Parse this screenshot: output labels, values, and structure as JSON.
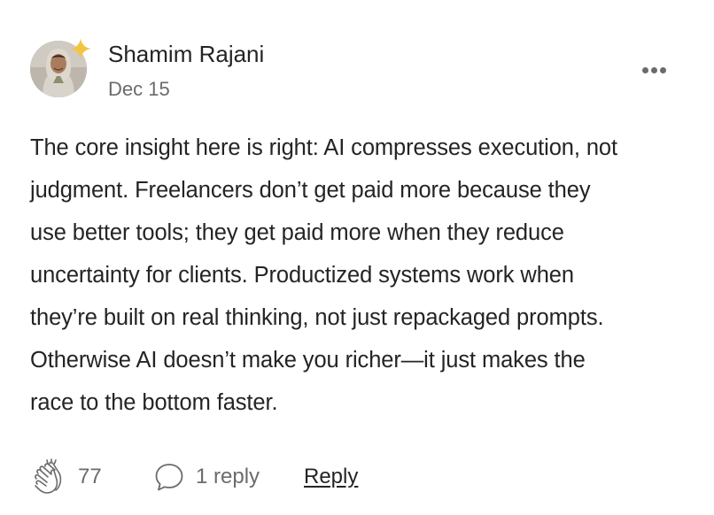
{
  "comment": {
    "author": {
      "name": "Shamim Rajani",
      "avatar_icon": "user-avatar-photo",
      "badge_icon": "sparkle-star-icon",
      "badge_color": "#F4C542"
    },
    "date": "Dec 15",
    "body": "The core insight here is right: AI compresses execution, not\njudgment. Freelancers don’t get paid more because they\nuse better tools; they get paid more when they reduce\nuncertainty for clients. Productized systems work when\nthey’re built on real thinking, not just repackaged prompts.\nOtherwise AI doesn’t make you richer—it just makes the\nrace to the bottom faster.",
    "menu_icon": "more-horizontal-icon",
    "actions": {
      "clap_icon": "clap-icon",
      "clap_count": "77",
      "responses_icon": "speech-bubble-icon",
      "responses_label": "1 reply",
      "reply_label": "Reply"
    }
  },
  "colors": {
    "text_primary": "#242424",
    "text_secondary": "#6b6b6b",
    "background": "#ffffff"
  }
}
